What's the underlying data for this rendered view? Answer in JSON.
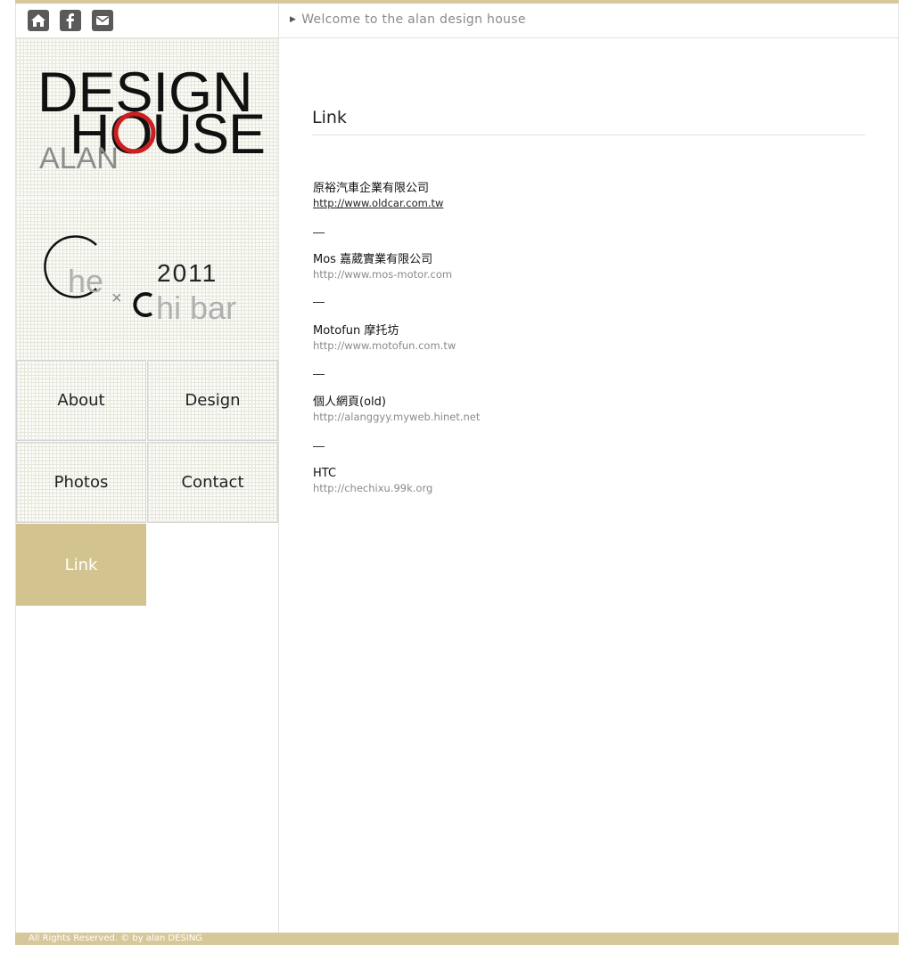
{
  "header": {
    "welcome": "Welcome  to the alan design house",
    "icons": [
      "home-icon",
      "facebook-icon",
      "mail-icon"
    ]
  },
  "logo": {
    "line1": "DESIGN",
    "line2": "HOUSE",
    "name": "ALAN"
  },
  "banner": {
    "che": "he",
    "year": "2011",
    "chi": "hi bar",
    "x": "×"
  },
  "nav": {
    "about": "About",
    "design": "Design",
    "photos": "Photos",
    "contact": "Contact",
    "link": "Link"
  },
  "main": {
    "title": "Link",
    "links": [
      {
        "name": "原裕汽車企業有限公司",
        "url": "http://www.oldcar.com.tw"
      },
      {
        "name": "Mos 嘉葳實業有限公司",
        "url": "http://www.mos-motor.com"
      },
      {
        "name": "Motofun 摩托坊",
        "url": "http://www.motofun.com.tw"
      },
      {
        "name": "個人網頁(old)",
        "url": "http://alanggyy.myweb.hinet.net"
      },
      {
        "name": "HTC",
        "url": "http://chechixu.99k.org"
      }
    ]
  },
  "footer": {
    "text": "All Rights Reserved. © by alan DESING"
  },
  "colors": {
    "accent": "#d6c89a",
    "active_nav": "#d3c48f",
    "logo_red": "#cc1f1f"
  }
}
